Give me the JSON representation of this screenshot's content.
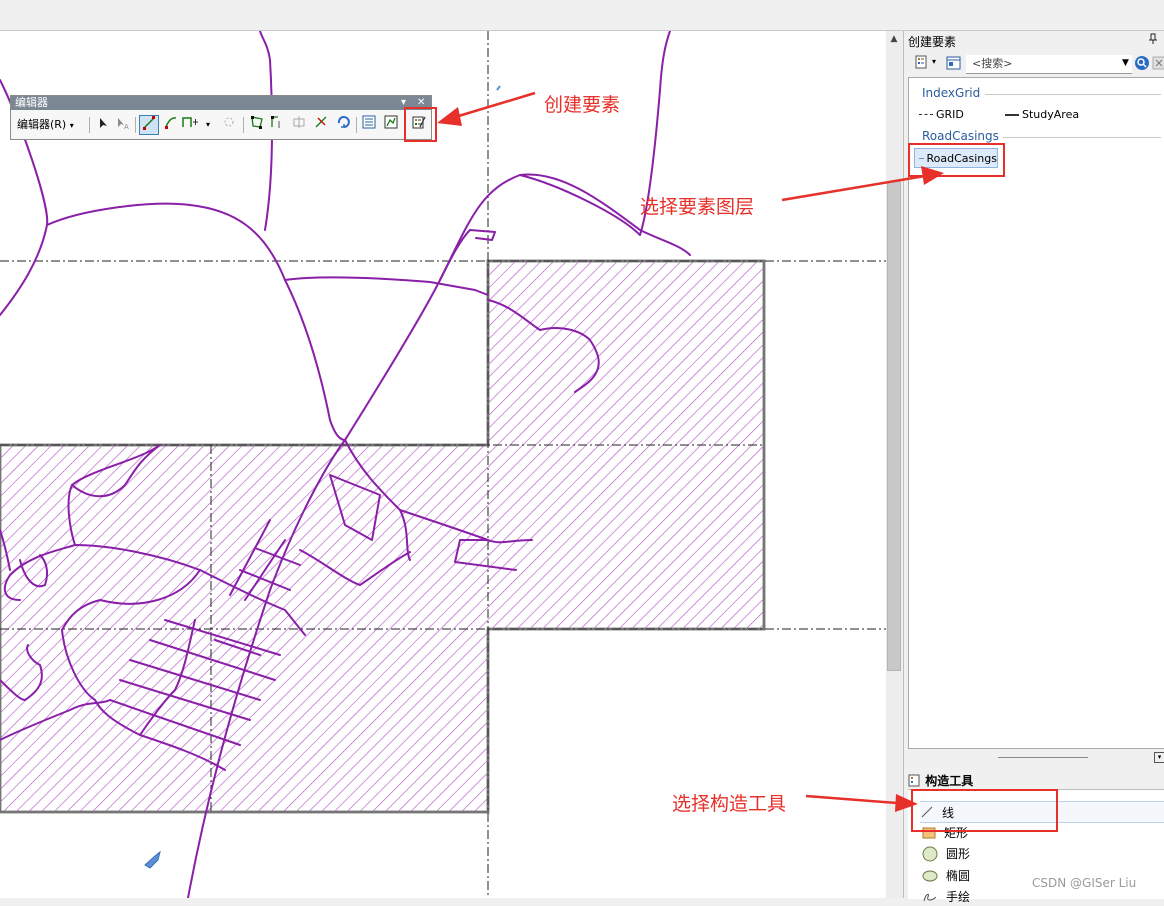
{
  "editor_toolbar": {
    "title": "编辑器",
    "menu_label": "编辑器(R)",
    "pin_glyph": "▾",
    "close_glyph": "✕"
  },
  "create_features_panel": {
    "title": "创建要素",
    "pin_glyph": "🖈",
    "search_placeholder": "<搜索>",
    "groups": [
      {
        "name": "IndexGrid",
        "templates": [
          "GRID",
          "StudyArea"
        ]
      },
      {
        "name": "RoadCasings",
        "templates": [
          "RoadCasings"
        ]
      }
    ],
    "selected_template": "RoadCasings"
  },
  "construction_tools": {
    "title": "构造工具",
    "tools": [
      {
        "label": "线",
        "icon": "line-icon",
        "selected": true
      },
      {
        "label": "矩形",
        "icon": "rectangle-icon",
        "selected": false
      },
      {
        "label": "圆形",
        "icon": "circle-icon",
        "selected": false
      },
      {
        "label": "椭圆",
        "icon": "ellipse-icon",
        "selected": false
      },
      {
        "label": "手绘",
        "icon": "freehand-icon",
        "selected": false
      }
    ]
  },
  "annotations": {
    "create_features": "创建要素",
    "select_layer": "选择要素图层",
    "select_tool": "选择构造工具"
  },
  "watermark": "CSDN @GISer Liu",
  "colors": {
    "road": "#8a1fa8",
    "hatch": "#b04cc4",
    "annotation_red": "#e8302a",
    "group_header": "#2a5d9c"
  }
}
